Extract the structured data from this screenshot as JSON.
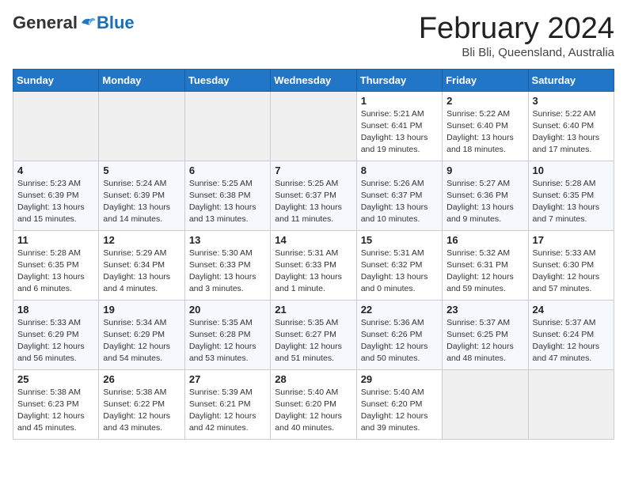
{
  "header": {
    "logo_general": "General",
    "logo_blue": "Blue",
    "title": "February 2024",
    "subtitle": "Bli Bli, Queensland, Australia"
  },
  "calendar": {
    "days_of_week": [
      "Sunday",
      "Monday",
      "Tuesday",
      "Wednesday",
      "Thursday",
      "Friday",
      "Saturday"
    ],
    "weeks": [
      [
        {
          "day": "",
          "info": ""
        },
        {
          "day": "",
          "info": ""
        },
        {
          "day": "",
          "info": ""
        },
        {
          "day": "",
          "info": ""
        },
        {
          "day": "1",
          "info": "Sunrise: 5:21 AM\nSunset: 6:41 PM\nDaylight: 13 hours\nand 19 minutes."
        },
        {
          "day": "2",
          "info": "Sunrise: 5:22 AM\nSunset: 6:40 PM\nDaylight: 13 hours\nand 18 minutes."
        },
        {
          "day": "3",
          "info": "Sunrise: 5:22 AM\nSunset: 6:40 PM\nDaylight: 13 hours\nand 17 minutes."
        }
      ],
      [
        {
          "day": "4",
          "info": "Sunrise: 5:23 AM\nSunset: 6:39 PM\nDaylight: 13 hours\nand 15 minutes."
        },
        {
          "day": "5",
          "info": "Sunrise: 5:24 AM\nSunset: 6:39 PM\nDaylight: 13 hours\nand 14 minutes."
        },
        {
          "day": "6",
          "info": "Sunrise: 5:25 AM\nSunset: 6:38 PM\nDaylight: 13 hours\nand 13 minutes."
        },
        {
          "day": "7",
          "info": "Sunrise: 5:25 AM\nSunset: 6:37 PM\nDaylight: 13 hours\nand 11 minutes."
        },
        {
          "day": "8",
          "info": "Sunrise: 5:26 AM\nSunset: 6:37 PM\nDaylight: 13 hours\nand 10 minutes."
        },
        {
          "day": "9",
          "info": "Sunrise: 5:27 AM\nSunset: 6:36 PM\nDaylight: 13 hours\nand 9 minutes."
        },
        {
          "day": "10",
          "info": "Sunrise: 5:28 AM\nSunset: 6:35 PM\nDaylight: 13 hours\nand 7 minutes."
        }
      ],
      [
        {
          "day": "11",
          "info": "Sunrise: 5:28 AM\nSunset: 6:35 PM\nDaylight: 13 hours\nand 6 minutes."
        },
        {
          "day": "12",
          "info": "Sunrise: 5:29 AM\nSunset: 6:34 PM\nDaylight: 13 hours\nand 4 minutes."
        },
        {
          "day": "13",
          "info": "Sunrise: 5:30 AM\nSunset: 6:33 PM\nDaylight: 13 hours\nand 3 minutes."
        },
        {
          "day": "14",
          "info": "Sunrise: 5:31 AM\nSunset: 6:33 PM\nDaylight: 13 hours\nand 1 minute."
        },
        {
          "day": "15",
          "info": "Sunrise: 5:31 AM\nSunset: 6:32 PM\nDaylight: 13 hours\nand 0 minutes."
        },
        {
          "day": "16",
          "info": "Sunrise: 5:32 AM\nSunset: 6:31 PM\nDaylight: 12 hours\nand 59 minutes."
        },
        {
          "day": "17",
          "info": "Sunrise: 5:33 AM\nSunset: 6:30 PM\nDaylight: 12 hours\nand 57 minutes."
        }
      ],
      [
        {
          "day": "18",
          "info": "Sunrise: 5:33 AM\nSunset: 6:29 PM\nDaylight: 12 hours\nand 56 minutes."
        },
        {
          "day": "19",
          "info": "Sunrise: 5:34 AM\nSunset: 6:29 PM\nDaylight: 12 hours\nand 54 minutes."
        },
        {
          "day": "20",
          "info": "Sunrise: 5:35 AM\nSunset: 6:28 PM\nDaylight: 12 hours\nand 53 minutes."
        },
        {
          "day": "21",
          "info": "Sunrise: 5:35 AM\nSunset: 6:27 PM\nDaylight: 12 hours\nand 51 minutes."
        },
        {
          "day": "22",
          "info": "Sunrise: 5:36 AM\nSunset: 6:26 PM\nDaylight: 12 hours\nand 50 minutes."
        },
        {
          "day": "23",
          "info": "Sunrise: 5:37 AM\nSunset: 6:25 PM\nDaylight: 12 hours\nand 48 minutes."
        },
        {
          "day": "24",
          "info": "Sunrise: 5:37 AM\nSunset: 6:24 PM\nDaylight: 12 hours\nand 47 minutes."
        }
      ],
      [
        {
          "day": "25",
          "info": "Sunrise: 5:38 AM\nSunset: 6:23 PM\nDaylight: 12 hours\nand 45 minutes."
        },
        {
          "day": "26",
          "info": "Sunrise: 5:38 AM\nSunset: 6:22 PM\nDaylight: 12 hours\nand 43 minutes."
        },
        {
          "day": "27",
          "info": "Sunrise: 5:39 AM\nSunset: 6:21 PM\nDaylight: 12 hours\nand 42 minutes."
        },
        {
          "day": "28",
          "info": "Sunrise: 5:40 AM\nSunset: 6:20 PM\nDaylight: 12 hours\nand 40 minutes."
        },
        {
          "day": "29",
          "info": "Sunrise: 5:40 AM\nSunset: 6:20 PM\nDaylight: 12 hours\nand 39 minutes."
        },
        {
          "day": "",
          "info": ""
        },
        {
          "day": "",
          "info": ""
        }
      ]
    ]
  }
}
